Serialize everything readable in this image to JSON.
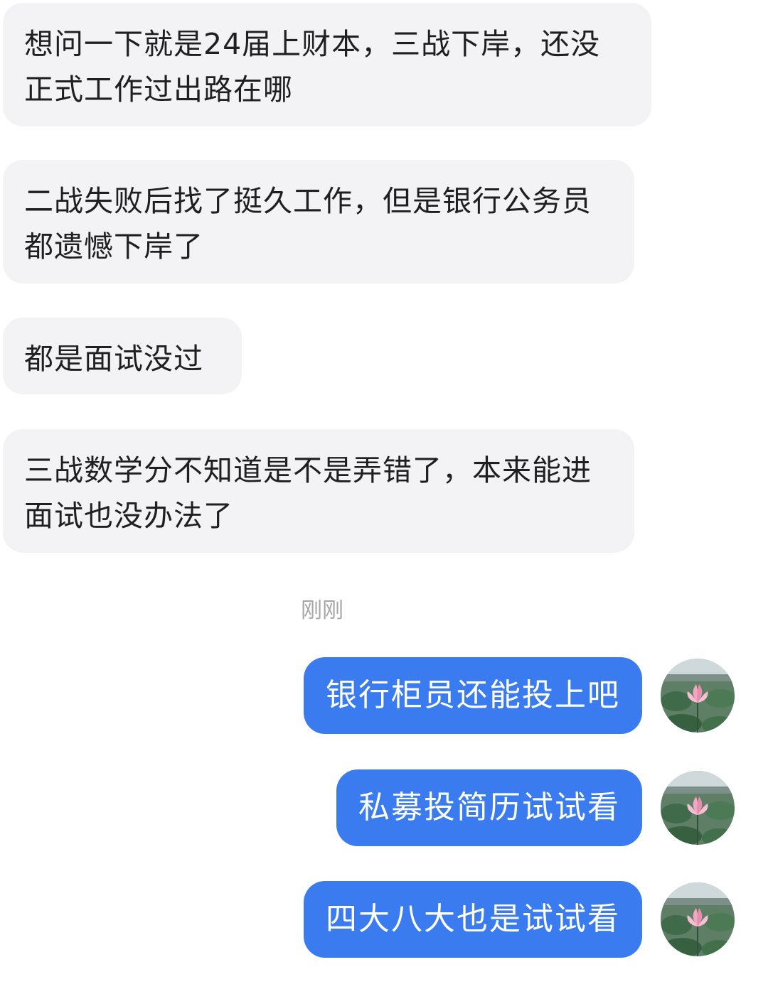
{
  "messages_incoming": [
    {
      "text": "想问一下就是24届上财本，三战下岸，还没正式工作过出路在哪"
    },
    {
      "text": "二战失败后找了挺久工作，但是银行公务员都遗憾下岸了"
    },
    {
      "text": "都是面试没过"
    },
    {
      "text": "三战数学分不知道是不是弄错了，本来能进面试也没办法了"
    }
  ],
  "timestamp": "刚刚",
  "messages_outgoing": [
    {
      "text": "银行柜员还能投上吧",
      "avatar_icon": "lotus-avatar-icon"
    },
    {
      "text": "私募投简历试试看",
      "avatar_icon": "lotus-avatar-icon"
    },
    {
      "text": "四大八大也是试试看",
      "avatar_icon": "lotus-avatar-icon"
    }
  ],
  "colors": {
    "incoming_bubble": "#f3f3f5",
    "outgoing_bubble": "#3a7cf0",
    "timestamp_text": "#a6a6a6"
  }
}
